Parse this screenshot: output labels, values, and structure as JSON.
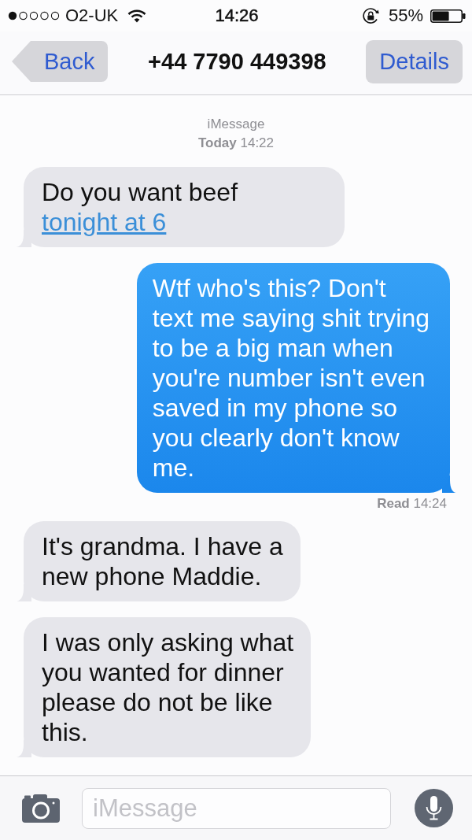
{
  "status_bar": {
    "carrier": "O2-UK",
    "time": "14:26",
    "battery": "55%"
  },
  "nav_bar": {
    "back": "Back",
    "title": "+44 7790 449398",
    "details": "Details"
  },
  "conversation": {
    "service": "iMessage",
    "timestamp": "**Today** 14:22",
    "messages": [
      {
        "kind": "received",
        "text": "Do you want beef",
        "link": "tonight at 6"
      },
      {
        "kind": "sent",
        "text": "Wtf who's this? Don't\ntext me saying shit trying\nto be a big man when\nyou're number isn't even\nsaved in my phone so\nyou clearly don't know\nme.",
        "receipt": "**Read** 14:24"
      },
      {
        "kind": "received",
        "text": "It's grandma. I have a\nnew phone Maddie."
      },
      {
        "kind": "received",
        "text": "I was only asking what\nyou wanted for dinner\nplease do not be like\nthis."
      }
    ]
  },
  "composer": {
    "placeholder": "iMessage"
  }
}
